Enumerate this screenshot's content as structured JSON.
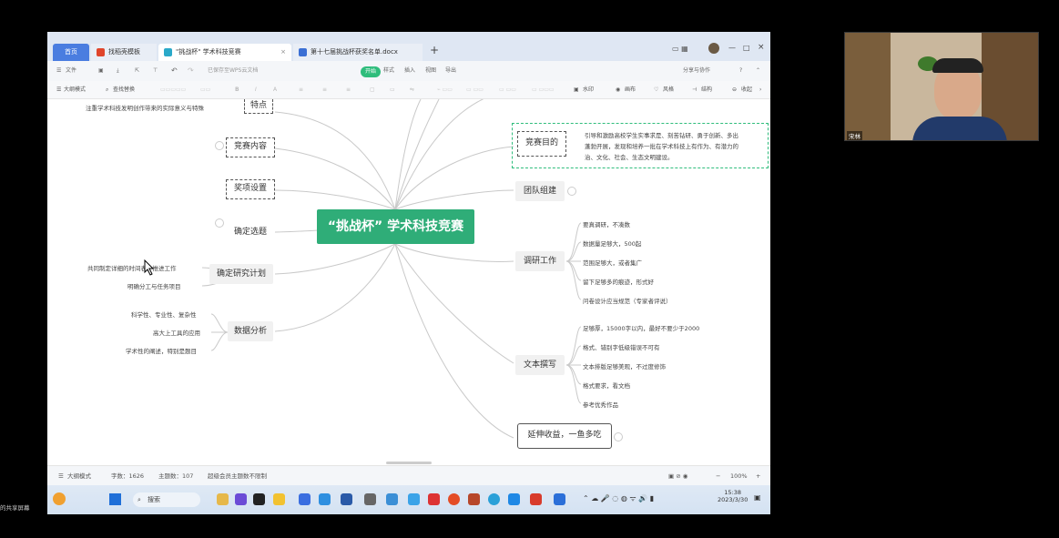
{
  "tabs": {
    "home": "首页",
    "templates": "找稻壳模板",
    "active_doc": "\"挑战杯\" 学术科技竞赛",
    "other_doc": "第十七届挑战杯获奖名单.docx"
  },
  "menubar": {
    "file": "文件",
    "save_status": "已保存至WPS云文档",
    "start": "开始",
    "style": "样式",
    "insert": "插入",
    "view": "视图",
    "export": "导出",
    "share": "分享与协作"
  },
  "toolbar": {
    "outline_mode": "大纲模式",
    "find_replace": "查找替换",
    "watermark": "水印",
    "canvas": "画布",
    "style": "风格",
    "structure": "结构",
    "collapse": "收起"
  },
  "mindmap": {
    "central": "“挑战杯” 学术科技竞赛",
    "left": {
      "features": "特点",
      "features_leaf": "注重学术科技发明创作带来的实际意义与特殊",
      "content": "竞赛内容",
      "awards": "奖项设置",
      "topic": "确定选题",
      "plan": "确定研究计划",
      "plan_leaves": [
        "共同制定详细的时间表，推进工作",
        "明确分工与任务项目"
      ],
      "analysis": "数据分析",
      "analysis_leaves": [
        "科学性、专业性、复杂性",
        "高大上工具的应用",
        "学术性的阐述，特别是题目"
      ]
    },
    "right": {
      "goal": "竞赛目的",
      "goal_text": [
        "引导和激励高校学生实事求是、刻苦钻研、勇于创新、多出",
        "蓬勃开展，发现和培养一批在学术科技上有作为、有潜力的",
        "治、文化、社会、生态文明建设。"
      ],
      "team": "团队组建",
      "research": "调研工作",
      "research_leaves": [
        "要真调研，不凑数",
        "数据量足够大，500起",
        "范围足够大，或者集广",
        "留下足够多的痕迹，形式好",
        "问卷设计应当规范（专家者评说）"
      ],
      "writing": "文本撰写",
      "writing_leaves": [
        "足够厚，15000字以内，最好不要少于2000",
        "格式、错别字低级错误不可有",
        "文本排版足够美观，不过度修饰",
        "格式要求，看文档",
        "参考优秀作品"
      ],
      "extend": "延伸收益，一鱼多吃"
    }
  },
  "statusbar": {
    "mode": "大纲模式",
    "word_count": "字数：1626",
    "topic_count": "主题数：107",
    "note": "超级会员主题数不限制",
    "zoom": "100%"
  },
  "taskbar": {
    "search": "搜索",
    "time": "15:38",
    "date": "2023/3/30"
  },
  "overlay": {
    "webcam_name": "宋林",
    "share_label": "的共享屏幕"
  },
  "colors": {
    "accent": "#2fad78",
    "tab_active": "#4a7de0"
  }
}
